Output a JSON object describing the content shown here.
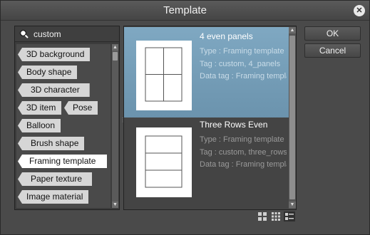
{
  "window": {
    "title": "Template"
  },
  "search": {
    "value": "custom"
  },
  "tags": [
    {
      "label": "3D background"
    },
    {
      "label": "Body shape"
    },
    {
      "label": "3D character"
    },
    {
      "label": "3D item"
    },
    {
      "label": "Pose"
    },
    {
      "label": "Balloon"
    },
    {
      "label": "Brush shape"
    },
    {
      "label": "Framing template",
      "selected": true
    },
    {
      "label": "Paper texture"
    },
    {
      "label": "Image material"
    }
  ],
  "items": [
    {
      "title": "4 even panels",
      "type": "Type : Framing template",
      "tag": "Tag : custom, 4_panels",
      "data_tag": "Data tag : Framing template",
      "selected": true
    },
    {
      "title": "Three Rows Even",
      "type": "Type : Framing template",
      "tag": "Tag : custom, three_rows",
      "data_tag": "Data tag : Framing template",
      "selected": false
    }
  ],
  "buttons": {
    "ok": "OK",
    "cancel": "Cancel"
  },
  "icons": {
    "close": "close-icon",
    "search": "search-icon",
    "view_large": "large-thumbnail-view-icon",
    "view_small": "small-thumbnail-view-icon",
    "view_list": "list-view-icon"
  }
}
